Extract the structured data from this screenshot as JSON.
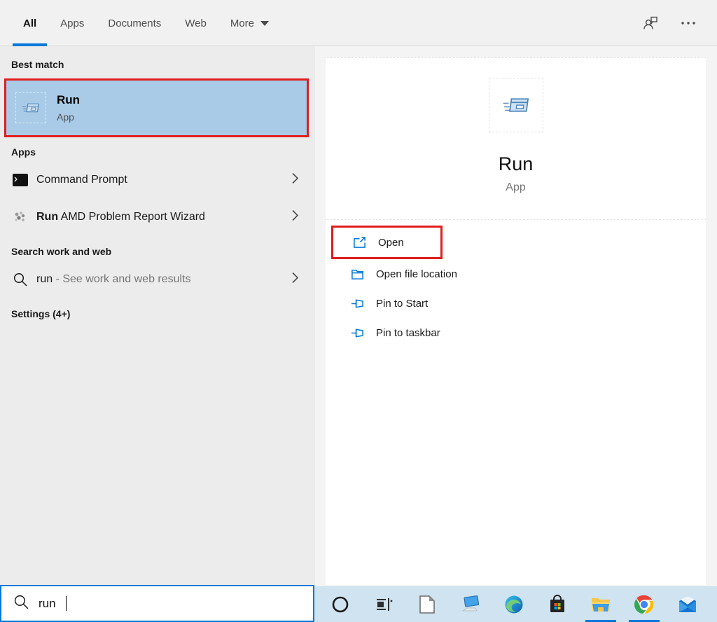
{
  "colors": {
    "accent": "#0078d7",
    "highlight": "#a9cbe8",
    "annotation": "#e11d1d",
    "taskbar_bg": "#cfe3f0"
  },
  "header": {
    "tabs": [
      {
        "label": "All",
        "active": true
      },
      {
        "label": "Apps",
        "active": false
      },
      {
        "label": "Documents",
        "active": false
      },
      {
        "label": "Web",
        "active": false
      },
      {
        "label": "More",
        "active": false,
        "dropdown": true
      }
    ],
    "icons": {
      "feedback": "person-chat-icon",
      "more_options": "ellipsis-icon"
    }
  },
  "results": {
    "best_match": {
      "header": "Best match",
      "title": "Run",
      "subtitle": "App",
      "icon": "run-app-icon",
      "selected": true,
      "annotated": true
    },
    "apps": {
      "header": "Apps",
      "items": [
        {
          "prefix": "",
          "text": "Command Prompt",
          "icon": "command-prompt-icon"
        },
        {
          "prefix": "Run",
          "text": " AMD Problem Report Wizard",
          "icon": "amd-wizard-icon"
        }
      ]
    },
    "web": {
      "header": "Search work and web",
      "query": "run",
      "suffix": " - See work and web results",
      "icon": "search-icon"
    },
    "settings": {
      "header": "Settings (4+)"
    }
  },
  "preview": {
    "title": "Run",
    "subtitle": "App",
    "icon": "run-app-icon",
    "actions": [
      {
        "label": "Open",
        "icon": "open-icon",
        "annotated": true
      },
      {
        "label": "Open file location",
        "icon": "folder-icon",
        "annotated": false
      },
      {
        "label": "Pin to Start",
        "icon": "pin-icon",
        "annotated": false
      },
      {
        "label": "Pin to taskbar",
        "icon": "pin-icon",
        "annotated": false
      }
    ]
  },
  "search_bar": {
    "value": "run",
    "icon": "search-icon"
  },
  "taskbar": {
    "items": [
      {
        "name": "cortana",
        "active": false
      },
      {
        "name": "task-view",
        "active": false
      },
      {
        "name": "libreoffice",
        "active": false
      },
      {
        "name": "this-pc",
        "active": false
      },
      {
        "name": "microsoft-edge",
        "active": false
      },
      {
        "name": "microsoft-store",
        "active": false
      },
      {
        "name": "file-explorer",
        "active": true
      },
      {
        "name": "google-chrome",
        "active": true
      },
      {
        "name": "mail",
        "active": false
      }
    ]
  }
}
